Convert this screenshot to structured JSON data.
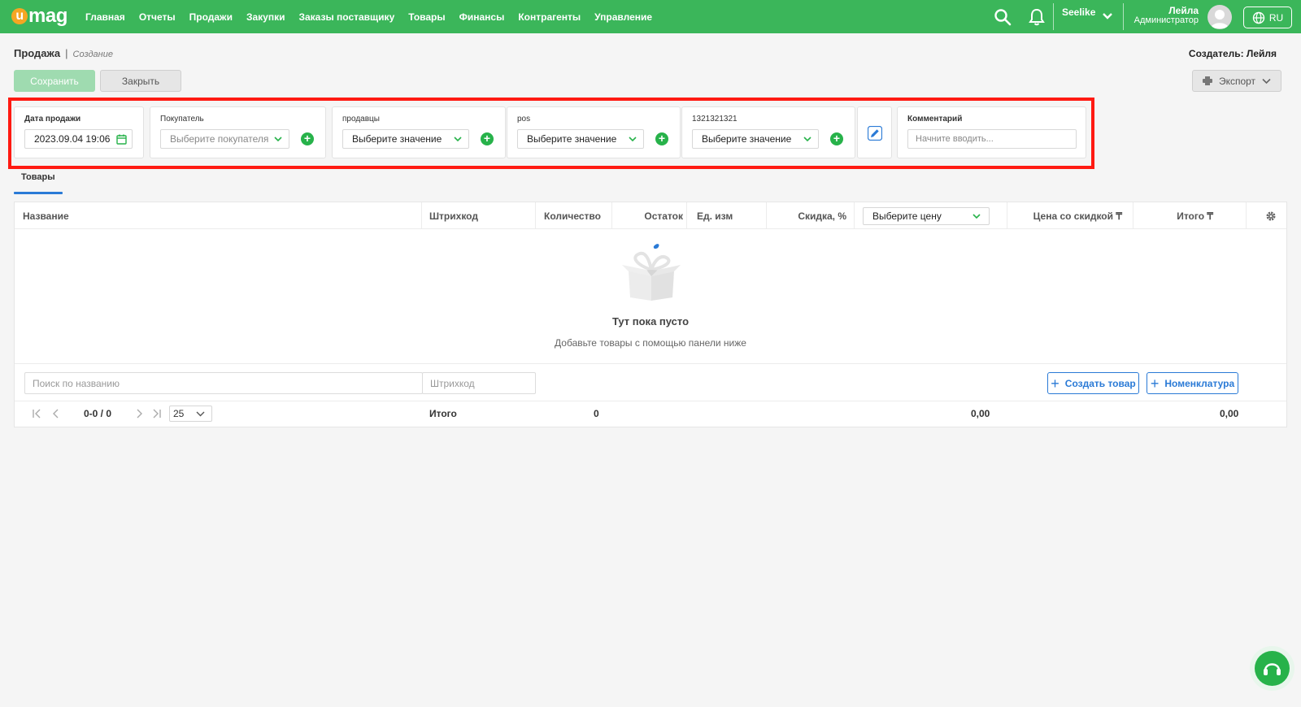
{
  "brand": {
    "logo_text": "mag",
    "logo_letter": "u",
    "accent_color": "#3bb65a",
    "logo_color": "#f5a623"
  },
  "nav": {
    "items": [
      "Главная",
      "Отчеты",
      "Продажи",
      "Закупки",
      "Заказы поставщику",
      "Товары",
      "Финансы",
      "Контрагенты",
      "Управление"
    ]
  },
  "topbar": {
    "store": "Seelike",
    "user_name": "Лейла",
    "user_role": "Администратор",
    "lang": "RU"
  },
  "page": {
    "title": "Продажа",
    "separator": "|",
    "subtitle": "Создание",
    "creator": "Создатель: Лейля"
  },
  "actions": {
    "save": "Сохранить",
    "close": "Закрыть",
    "export": "Экспорт"
  },
  "fields": {
    "sale_date": {
      "label": "Дата продажи",
      "value": "2023.09.04 19:06"
    },
    "buyer": {
      "label": "Покупатель",
      "placeholder": "Выберите покупателя"
    },
    "sellers": {
      "label": "продавцы",
      "value": "Выберите значение"
    },
    "pos": {
      "label": "pos",
      "value": "Выберите значение"
    },
    "custom": {
      "label": "1321321321",
      "value": "Выберите значение"
    },
    "comment": {
      "label": "Комментарий",
      "placeholder": "Начните вводить..."
    }
  },
  "tabs": {
    "goods": "Товары"
  },
  "table": {
    "columns": {
      "name": "Название",
      "barcode": "Штрихкод",
      "quantity": "Количество",
      "stock": "Остаток",
      "unit": "Ед. изм",
      "discount": "Скидка, %",
      "price_select": "Выберите цену",
      "discounted_price": "Цена со скидкой ₸",
      "total": "Итого ₸"
    },
    "empty_title": "Тут пока пусто",
    "empty_subtitle": "Добавьте товары с помощью панели ниже",
    "search_placeholder": "Поиск по названию",
    "barcode_placeholder": "Штрихкод",
    "create_product": "Создать товар",
    "nomenclature": "Номенклатура"
  },
  "footer": {
    "range": "0-0 / 0",
    "page_size": "25",
    "total_label": "Итого",
    "total_qty": "0",
    "total_discounted": "0,00",
    "total_sum": "0,00"
  }
}
